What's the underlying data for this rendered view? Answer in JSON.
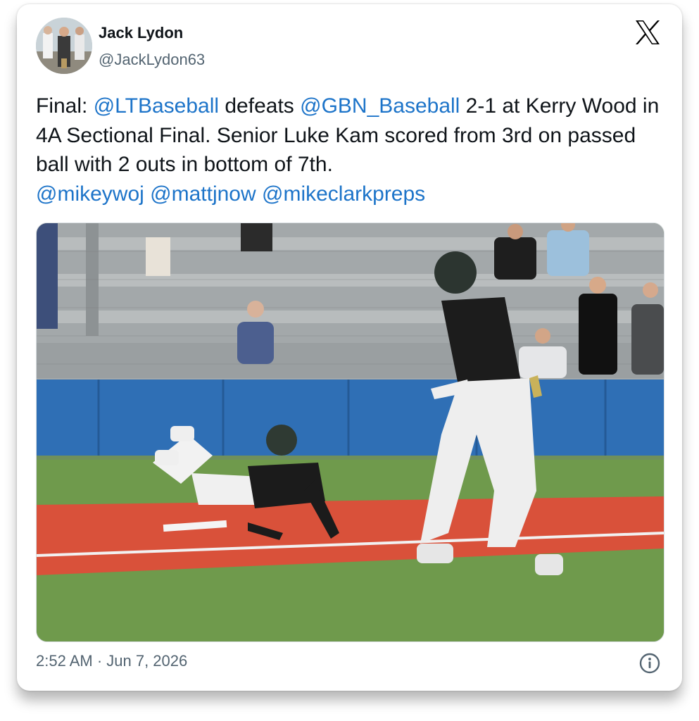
{
  "tweet": {
    "author": {
      "display_name": "Jack Lydon",
      "handle": "@JackLydon63"
    },
    "text_segments": [
      {
        "kind": "text",
        "value": "Final: "
      },
      {
        "kind": "mention",
        "value": "@LTBaseball"
      },
      {
        "kind": "text",
        "value": " defeats "
      },
      {
        "kind": "mention",
        "value": "@GBN_Baseball"
      },
      {
        "kind": "text",
        "value": " 2-1 at Kerry Wood in 4A Sectional Final. Senior Luke Kam scored from 3rd on passed ball with 2 outs in bottom of 7th."
      },
      {
        "kind": "break",
        "value": ""
      },
      {
        "kind": "mention",
        "value": "@mikeywoj"
      },
      {
        "kind": "text",
        "value": " "
      },
      {
        "kind": "mention",
        "value": "@mattjnow"
      },
      {
        "kind": "text",
        "value": " "
      },
      {
        "kind": "mention",
        "value": "@mikeclarkpreps"
      }
    ],
    "timestamp": "2:52 AM · Jun 7, 2026"
  },
  "icons": {
    "brand": "x-logo-icon",
    "info": "info-icon"
  },
  "colors": {
    "mention": "#1d74c9",
    "text": "#0f1419",
    "muted": "#536471",
    "outfield_wall": "#2f6fb5",
    "infield_clay": "#d9513a",
    "grass": "#6f9a4c"
  }
}
